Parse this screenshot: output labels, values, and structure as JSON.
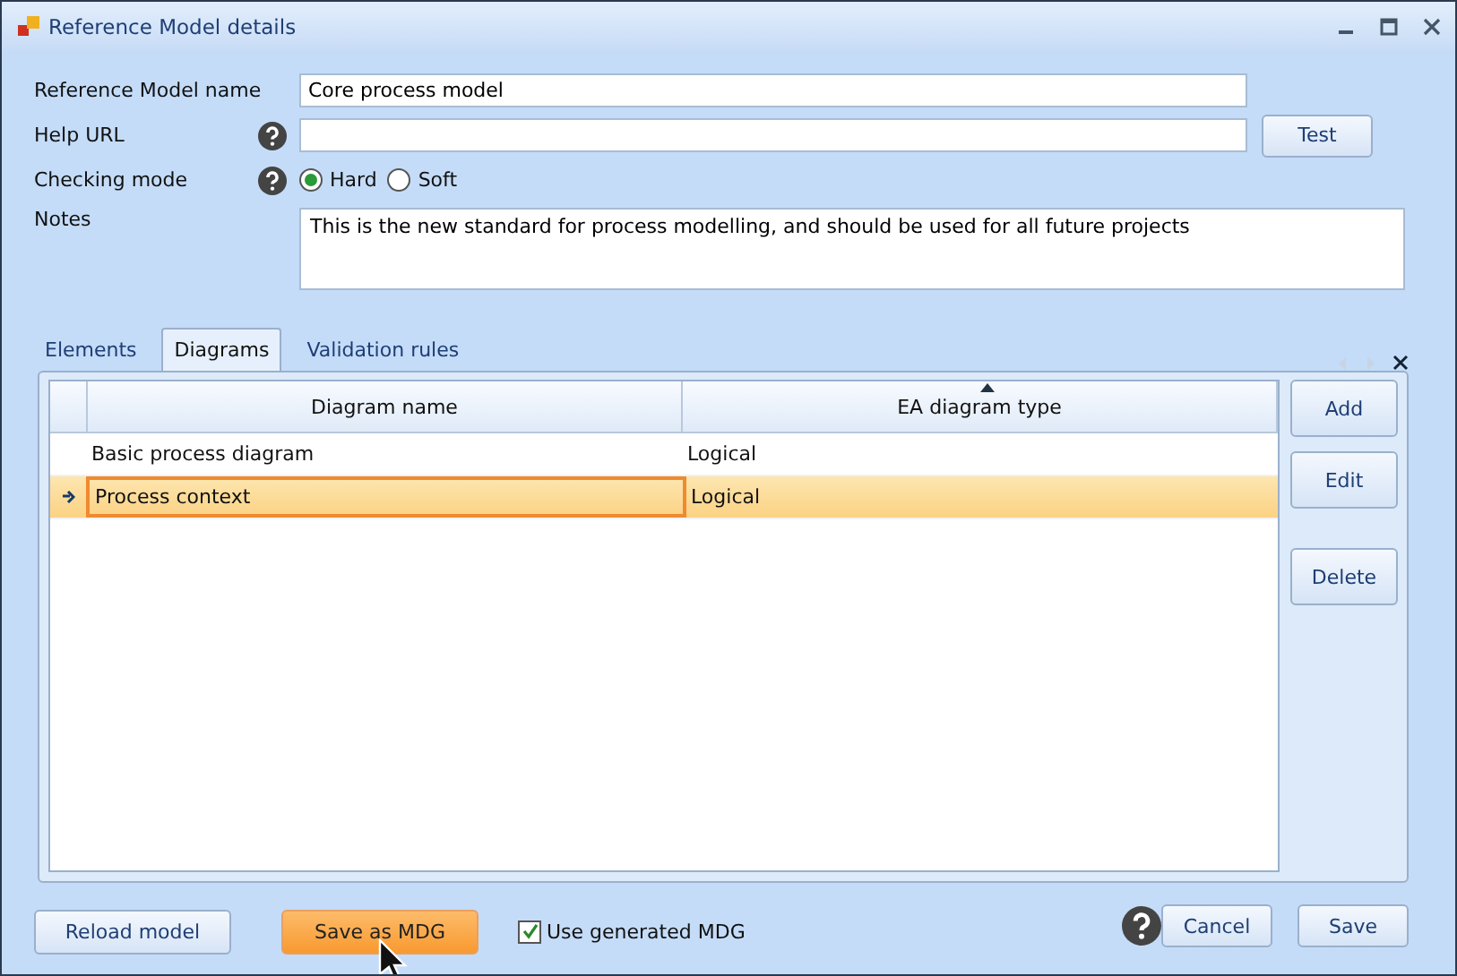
{
  "window": {
    "title": "Reference Model details"
  },
  "form": {
    "name_label": "Reference Model name",
    "name_value": "Core process model",
    "help_url_label": "Help URL",
    "test_button": "Test",
    "checking_mode_label": "Checking mode",
    "checking_modes": [
      {
        "label": "Hard",
        "selected": true
      },
      {
        "label": "Soft",
        "selected": false
      }
    ],
    "notes_label": "Notes",
    "notes_value": "This is the new standard for process modelling, and should be used for all future projects"
  },
  "tabs": [
    {
      "label": "Elements",
      "selected": false
    },
    {
      "label": "Diagrams",
      "selected": true
    },
    {
      "label": "Validation rules",
      "selected": false
    }
  ],
  "table": {
    "columns": [
      {
        "label": "Diagram name",
        "sorted": false
      },
      {
        "label": "EA diagram type",
        "sorted": true
      }
    ],
    "rows": [
      {
        "cells": [
          "Basic process diagram",
          "Logical"
        ],
        "selected": false
      },
      {
        "cells": [
          "Process context",
          "Logical"
        ],
        "selected": true
      }
    ]
  },
  "side_buttons": [
    "Add",
    "Edit",
    "Delete"
  ],
  "bottom": {
    "reload_button": "Reload model",
    "save_mdg_button": "Save as MDG",
    "use_generated": {
      "label": "Use generated MDG",
      "checked": true
    },
    "cancel_button": "Cancel",
    "save_button": "Save"
  }
}
